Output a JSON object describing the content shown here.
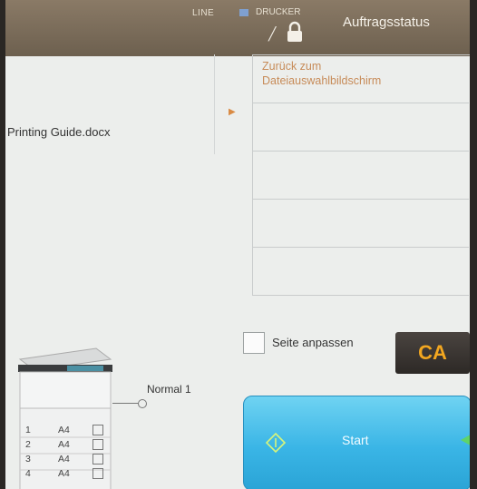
{
  "topbar": {
    "line_label": "LINE",
    "printer_label": "DRUCKER",
    "job_status_label": "Auftragsstatus"
  },
  "file": {
    "name": "Printing Guide.docx"
  },
  "file_list": {
    "back_line1": "Zurück zum",
    "back_line2": "Dateiauswahlbildschirm"
  },
  "fit_page": {
    "label": "Seite anpassen"
  },
  "ca_button": {
    "label": "CA"
  },
  "output": {
    "mode_label": "Normal 1"
  },
  "trays": [
    {
      "num": "1",
      "size": "A4"
    },
    {
      "num": "2",
      "size": "A4"
    },
    {
      "num": "3",
      "size": "A4"
    },
    {
      "num": "4",
      "size": "A4"
    }
  ],
  "start_button": {
    "label": "Start"
  },
  "colors": {
    "accent_orange": "#f3a720",
    "start_blue": "#3ab5e6",
    "topbar_brown": "#7b6d5a"
  }
}
